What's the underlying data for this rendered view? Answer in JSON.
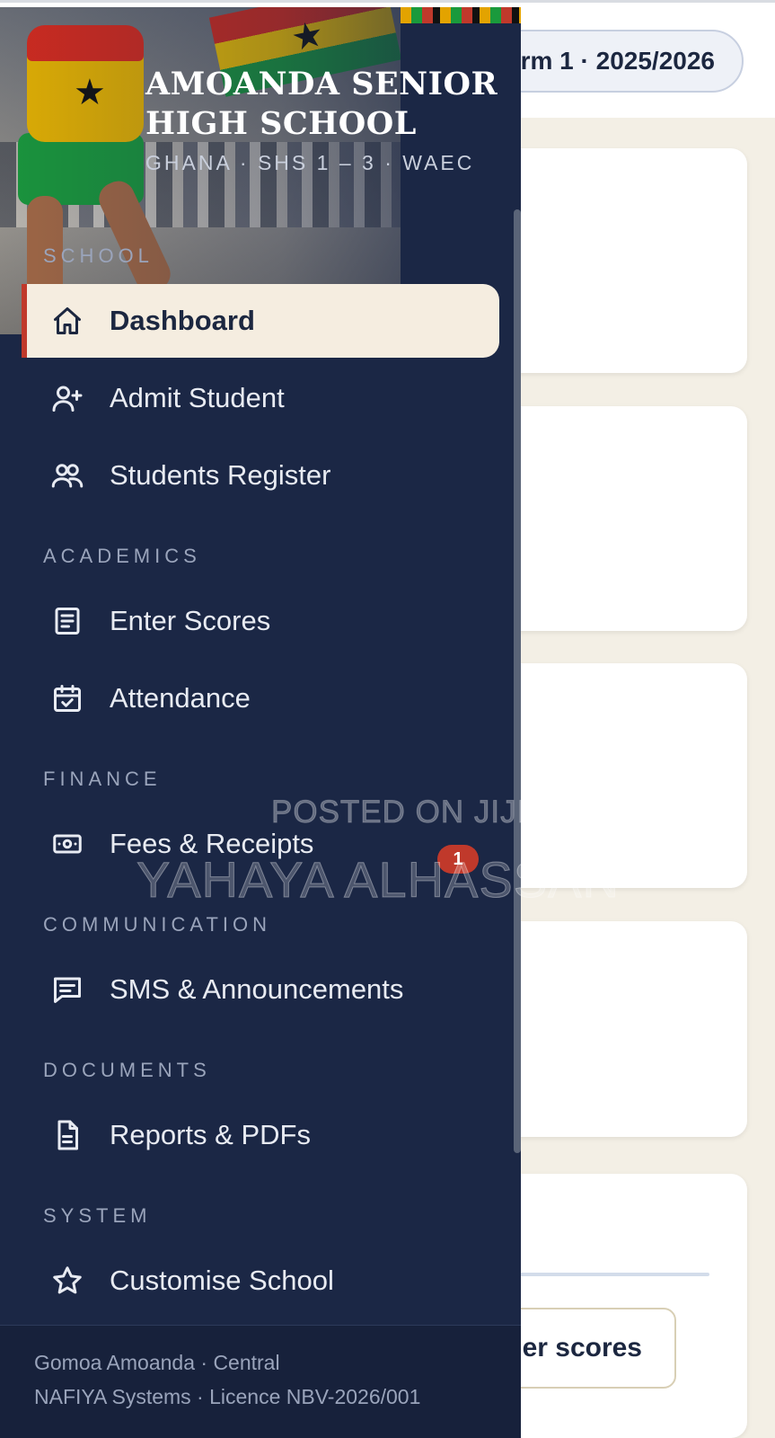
{
  "header": {
    "term_label": "rm 1 · 2025/2026"
  },
  "main": {
    "enter_scores_button": "er scores"
  },
  "drawer": {
    "school_name_line1": "AMOANDA SENIOR",
    "school_name_line2": "HIGH SCHOOL",
    "school_subtitle": "GHANA · SHS 1 – 3 · WAEC",
    "sections": [
      {
        "label": "SCHOOL",
        "items": [
          {
            "label": "Dashboard",
            "icon": "home-icon",
            "active": true
          },
          {
            "label": "Admit Student",
            "icon": "user-plus-icon"
          },
          {
            "label": "Students Register",
            "icon": "users-icon"
          }
        ]
      },
      {
        "label": "ACADEMICS",
        "items": [
          {
            "label": "Enter Scores",
            "icon": "document-list-icon"
          },
          {
            "label": "Attendance",
            "icon": "calendar-check-icon"
          }
        ]
      },
      {
        "label": "FINANCE",
        "items": [
          {
            "label": "Fees & Receipts",
            "icon": "cash-icon",
            "badge": "1"
          }
        ]
      },
      {
        "label": "COMMUNICATION",
        "items": [
          {
            "label": "SMS & Announcements",
            "icon": "message-icon"
          }
        ]
      },
      {
        "label": "DOCUMENTS",
        "items": [
          {
            "label": "Reports & PDFs",
            "icon": "file-icon"
          }
        ]
      },
      {
        "label": "SYSTEM",
        "items": [
          {
            "label": "Customise School",
            "icon": "star-icon"
          }
        ]
      }
    ],
    "footer": {
      "location": "Gomoa Amoanda · Central",
      "licence": "NAFIYA Systems · Licence NBV-2026/001"
    }
  },
  "watermark": {
    "line1": "POSTED ON JIJI",
    "line2": "YAHAYA ALHASSAN"
  },
  "colors": {
    "drawer_bg": "#1b2745",
    "active_bg": "#f5ede0",
    "accent_red": "#c0392b",
    "page_bg": "#f3efe5"
  }
}
